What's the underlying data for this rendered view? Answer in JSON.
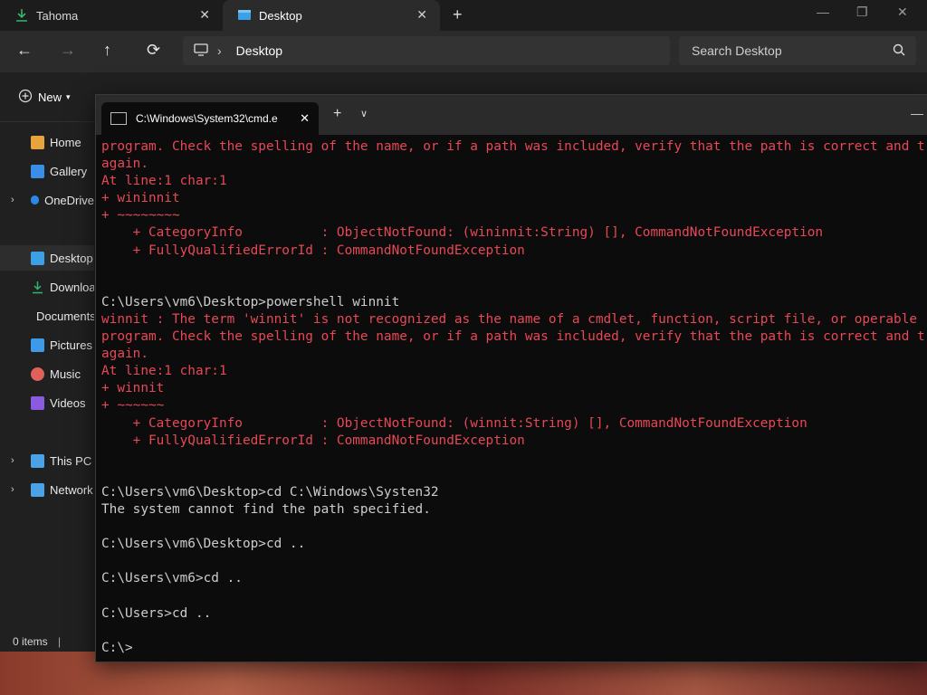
{
  "explorer": {
    "tabs": [
      {
        "label": "Tahoma",
        "active": false
      },
      {
        "label": "Desktop",
        "active": true
      }
    ],
    "breadcrumb": "Desktop",
    "search_placeholder": "Search Desktop",
    "new_label": "New",
    "sidebar": {
      "items": [
        {
          "label": "Home",
          "icon": "home-icon",
          "color": "#e8a33c"
        },
        {
          "label": "Gallery",
          "icon": "gallery-icon",
          "color": "#3b8ee6"
        },
        {
          "label": "OneDrive",
          "icon": "cloud-icon",
          "color": "#2d87e6"
        },
        {
          "label": "Desktop",
          "icon": "desktop-icon",
          "color": "#3ba0e6"
        },
        {
          "label": "Downloads",
          "icon": "download-icon",
          "color": "#35b36b"
        },
        {
          "label": "Documents",
          "icon": "document-icon",
          "color": "#8aa0b8"
        },
        {
          "label": "Pictures",
          "icon": "pictures-icon",
          "color": "#3d9ae8"
        },
        {
          "label": "Music",
          "icon": "music-icon",
          "color": "#e0605a"
        },
        {
          "label": "Videos",
          "icon": "videos-icon",
          "color": "#8a5ae0"
        },
        {
          "label": "This PC",
          "icon": "computer-icon",
          "color": "#4aa3e6"
        },
        {
          "label": "Network",
          "icon": "network-icon",
          "color": "#4aa3e6"
        }
      ]
    },
    "status": "0 items"
  },
  "terminal": {
    "tab_title": "C:\\Windows\\System32\\cmd.e",
    "lines": [
      {
        "text": "program. Check the spelling of the name, or if a path was included, verify that the path is correct and try",
        "style": "red"
      },
      {
        "text": "again.",
        "style": "red"
      },
      {
        "text": "At line:1 char:1",
        "style": "red"
      },
      {
        "text": "+ wininnit",
        "style": "red"
      },
      {
        "text": "+ ~~~~~~~~",
        "style": "red"
      },
      {
        "text": "    + CategoryInfo          : ObjectNotFound: (wininnit:String) [], CommandNotFoundException",
        "style": "red"
      },
      {
        "text": "    + FullyQualifiedErrorId : CommandNotFoundException",
        "style": "red"
      },
      {
        "text": "",
        "style": "norm"
      },
      {
        "text": "",
        "style": "norm"
      },
      {
        "text": "C:\\Users\\vm6\\Desktop>powershell winnit",
        "style": "norm"
      },
      {
        "text": "winnit : The term 'winnit' is not recognized as the name of a cmdlet, function, script file, or operable",
        "style": "red"
      },
      {
        "text": "program. Check the spelling of the name, or if a path was included, verify that the path is correct and try",
        "style": "red"
      },
      {
        "text": "again.",
        "style": "red"
      },
      {
        "text": "At line:1 char:1",
        "style": "red"
      },
      {
        "text": "+ winnit",
        "style": "red"
      },
      {
        "text": "+ ~~~~~~",
        "style": "red"
      },
      {
        "text": "    + CategoryInfo          : ObjectNotFound: (winnit:String) [], CommandNotFoundException",
        "style": "red"
      },
      {
        "text": "    + FullyQualifiedErrorId : CommandNotFoundException",
        "style": "red"
      },
      {
        "text": "",
        "style": "norm"
      },
      {
        "text": "",
        "style": "norm"
      },
      {
        "text": "C:\\Users\\vm6\\Desktop>cd C:\\Windows\\Systen32",
        "style": "norm"
      },
      {
        "text": "The system cannot find the path specified.",
        "style": "norm"
      },
      {
        "text": "",
        "style": "norm"
      },
      {
        "text": "C:\\Users\\vm6\\Desktop>cd ..",
        "style": "norm"
      },
      {
        "text": "",
        "style": "norm"
      },
      {
        "text": "C:\\Users\\vm6>cd ..",
        "style": "norm"
      },
      {
        "text": "",
        "style": "norm"
      },
      {
        "text": "C:\\Users>cd ..",
        "style": "norm"
      },
      {
        "text": "",
        "style": "norm"
      },
      {
        "text": "C:\\>",
        "style": "norm"
      }
    ]
  }
}
